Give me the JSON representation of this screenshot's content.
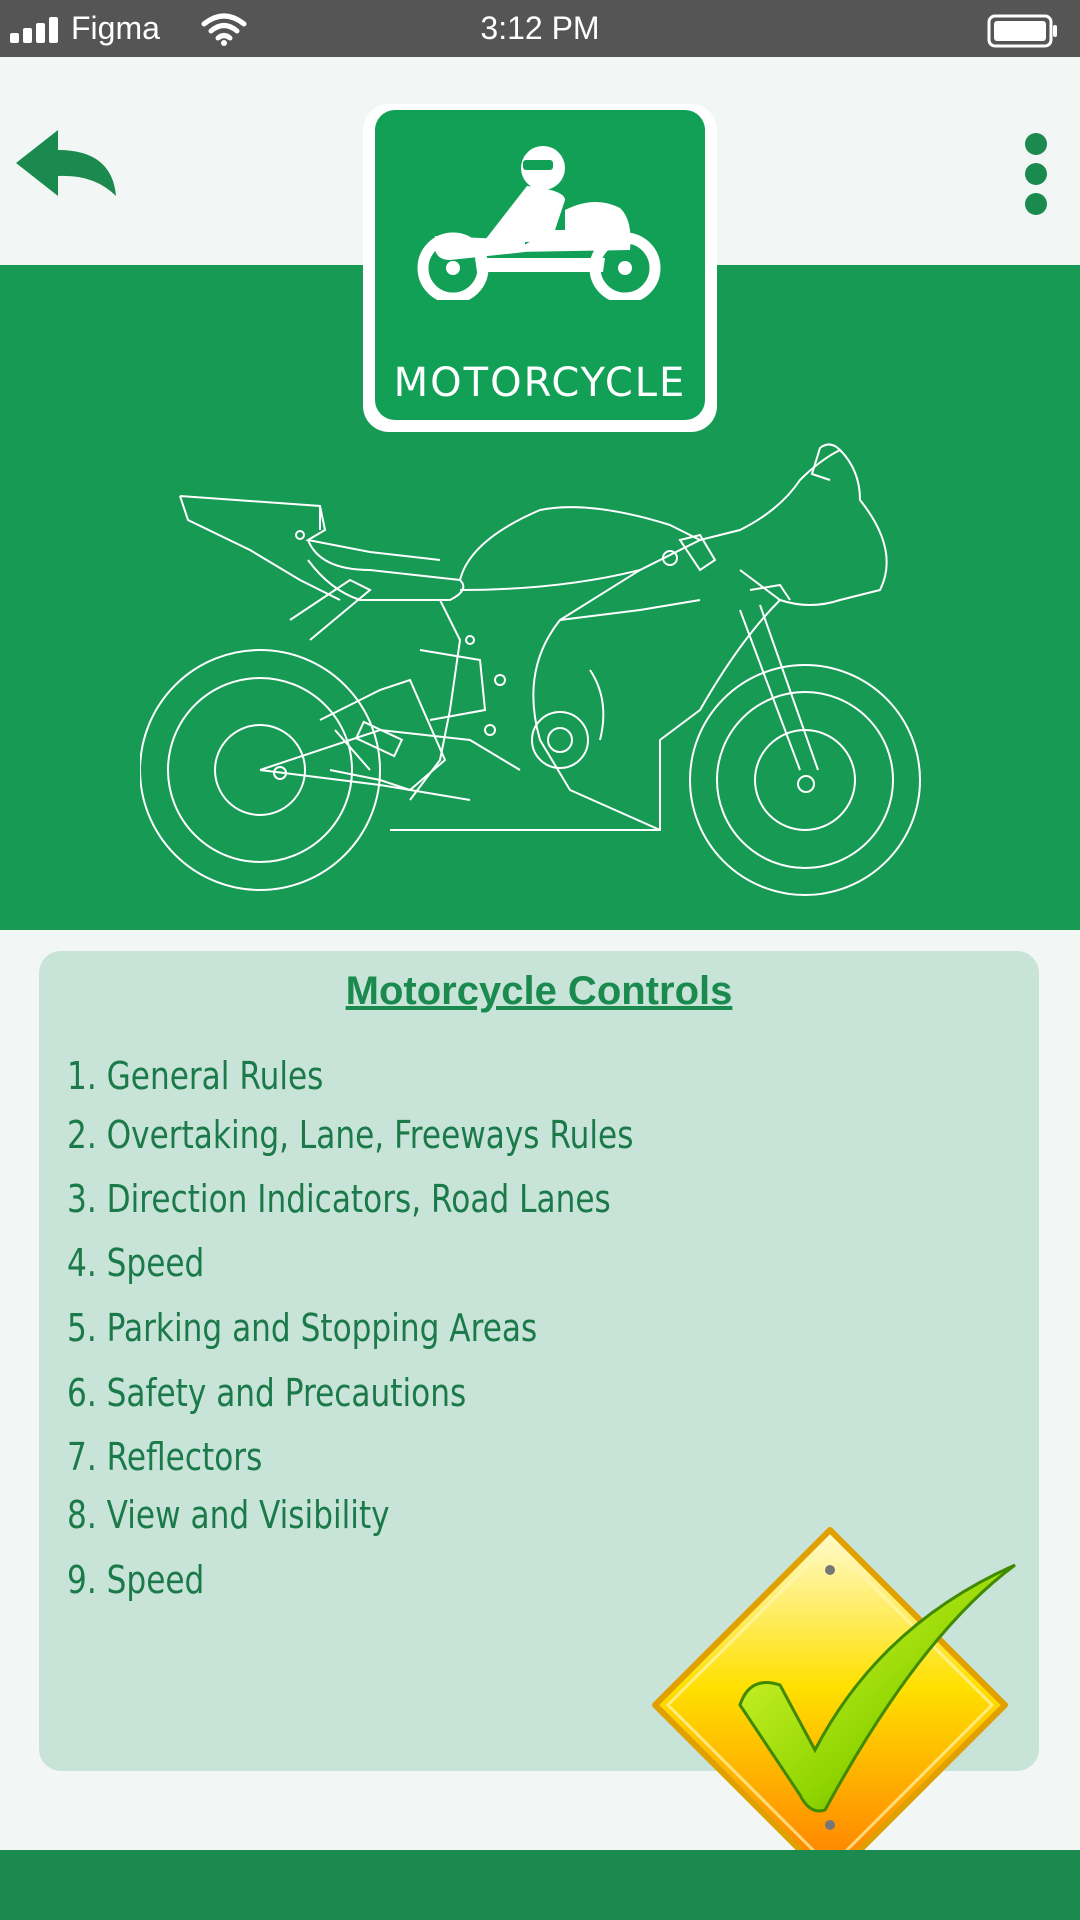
{
  "status": {
    "carrier": "Figma",
    "time": "3:12 PM"
  },
  "icons": {
    "back": "back-arrow-icon",
    "more": "more-vertical-icon",
    "badge": "motorcycle-rider-icon",
    "illustration": "motorcycle-outline",
    "check": "checkmark-sign-icon"
  },
  "badge": {
    "label": "MOTORCYCLE"
  },
  "card": {
    "title": "Motorcycle Controls",
    "items": [
      "1. General Rules",
      "2. Overtaking, Lane, Freeways Rules",
      "3. Direction Indicators, Road Lanes",
      "4. Speed",
      "5. Parking and Stopping Areas",
      "6. Safety and Precautions",
      "7. Reflectors",
      "8. View and Visibility",
      "9. Speed"
    ]
  },
  "colors": {
    "primary": "#179a54",
    "dark_green": "#1b8a4f",
    "card_bg": "#c8e3d7",
    "status_bar": "#555555",
    "sign_yellow": "#ffd200",
    "sign_orange": "#ff8a00"
  }
}
